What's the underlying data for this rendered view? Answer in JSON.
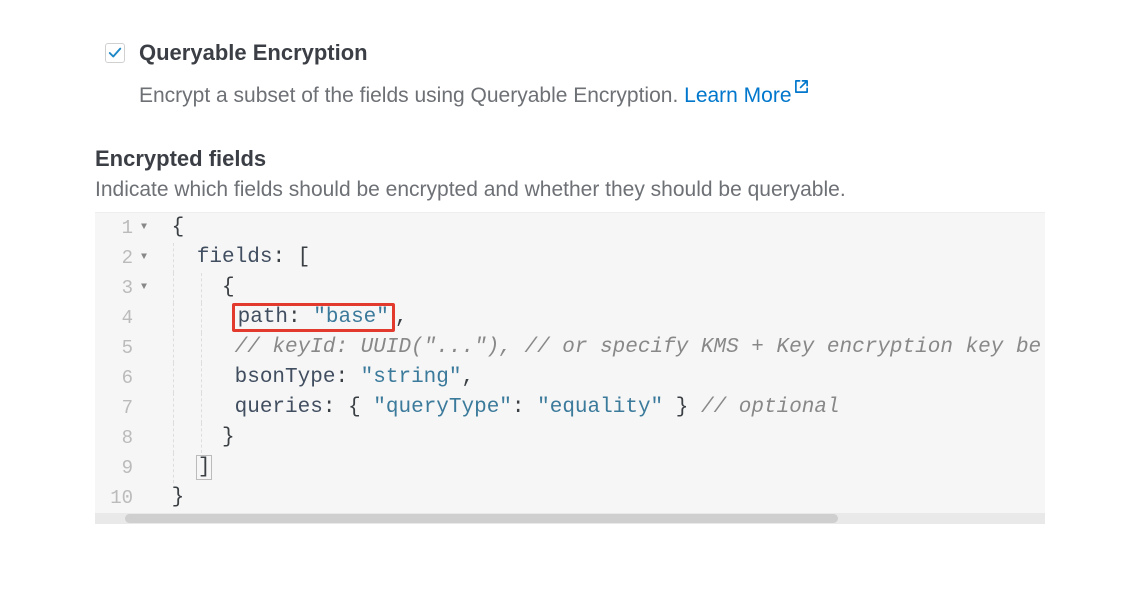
{
  "option": {
    "title": "Queryable Encryption",
    "description": "Encrypt a subset of the fields using Queryable Encryption. ",
    "learn_more": "Learn More",
    "checked": true
  },
  "section": {
    "title": "Encrypted fields",
    "description": "Indicate which fields should be encrypted and whether they should be queryable."
  },
  "code": {
    "lines": [
      {
        "num": "1",
        "fold": true
      },
      {
        "num": "2",
        "fold": true,
        "key_fields": "fields",
        "punc_colon": ":",
        "punc_open": "["
      },
      {
        "num": "3",
        "fold": true,
        "punc_brace": "{"
      },
      {
        "num": "4",
        "key_path": "path",
        "val_path": "\"base\""
      },
      {
        "num": "5",
        "comment": "// keyId: UUID(\"...\"), // or specify KMS + Key encryption key be"
      },
      {
        "num": "6",
        "key_bson": "bsonType",
        "val_bson": "\"string\""
      },
      {
        "num": "7",
        "key1": "queries",
        "k2": "\"queryType\"",
        "v2": "\"equality\"",
        "comment2": "// optional"
      },
      {
        "num": "8",
        "punc_close_brace": "}"
      },
      {
        "num": "9",
        "punc_close_sq": "]"
      },
      {
        "num": "10",
        "punc_final": "}"
      }
    ]
  }
}
